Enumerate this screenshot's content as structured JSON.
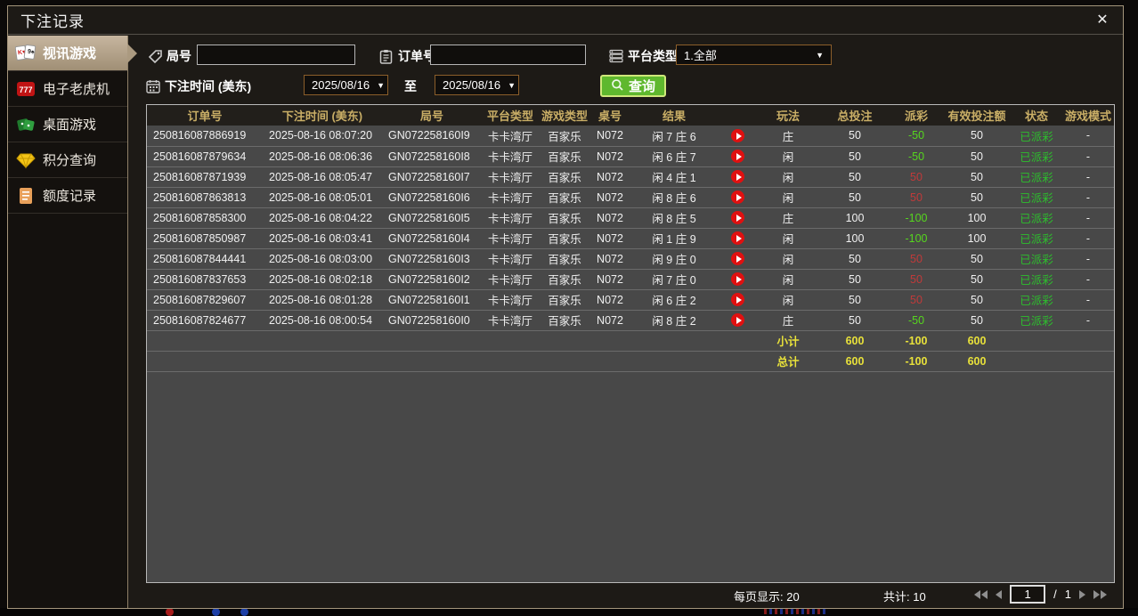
{
  "window": {
    "title": "下注记录",
    "close_glyph": "✕"
  },
  "sidebar": {
    "items": [
      {
        "label": "视讯游戏",
        "icon": "playing-cards-icon",
        "active": true
      },
      {
        "label": "电子老虎机",
        "icon": "slot-777-icon",
        "active": false
      },
      {
        "label": "桌面游戏",
        "icon": "dice-icon",
        "active": false
      },
      {
        "label": "积分查询",
        "icon": "diamond-icon",
        "active": false
      },
      {
        "label": "额度记录",
        "icon": "document-icon",
        "active": false
      }
    ]
  },
  "filters": {
    "round_label": "局号",
    "round_value": "",
    "order_label": "订单号",
    "order_value": "",
    "platform_label": "平台类型",
    "platform_value": "1.全部",
    "time_label": "下注时间 (美东)",
    "date_from": "2025/08/16",
    "to_label": "至",
    "date_to": "2025/08/16",
    "query_label": "查询"
  },
  "table": {
    "headers": [
      "订单号",
      "下注时间 (美东)",
      "局号",
      "平台类型",
      "游戏类型",
      "桌号",
      "结果",
      "",
      "玩法",
      "总投注",
      "派彩",
      "有效投注额",
      "状态",
      "游戏模式"
    ],
    "rows": [
      {
        "order_no": "250816087886919",
        "bet_time": "2025-08-16 08:07:20",
        "round_no": "GN072258160I9",
        "platform": "卡卡湾厅",
        "game_type": "百家乐",
        "table_no": "N072",
        "result": "闲 7 庄 6",
        "bet_type": "庄",
        "total_bet": "50",
        "payout": "-50",
        "payout_color": "green",
        "valid_bet": "50",
        "status": "已派彩",
        "mode": "-"
      },
      {
        "order_no": "250816087879634",
        "bet_time": "2025-08-16 08:06:36",
        "round_no": "GN072258160I8",
        "platform": "卡卡湾厅",
        "game_type": "百家乐",
        "table_no": "N072",
        "result": "闲 6 庄 7",
        "bet_type": "闲",
        "total_bet": "50",
        "payout": "-50",
        "payout_color": "green",
        "valid_bet": "50",
        "status": "已派彩",
        "mode": "-"
      },
      {
        "order_no": "250816087871939",
        "bet_time": "2025-08-16 08:05:47",
        "round_no": "GN072258160I7",
        "platform": "卡卡湾厅",
        "game_type": "百家乐",
        "table_no": "N072",
        "result": "闲 4 庄 1",
        "bet_type": "闲",
        "total_bet": "50",
        "payout": "50",
        "payout_color": "red",
        "valid_bet": "50",
        "status": "已派彩",
        "mode": "-"
      },
      {
        "order_no": "250816087863813",
        "bet_time": "2025-08-16 08:05:01",
        "round_no": "GN072258160I6",
        "platform": "卡卡湾厅",
        "game_type": "百家乐",
        "table_no": "N072",
        "result": "闲 8 庄 6",
        "bet_type": "闲",
        "total_bet": "50",
        "payout": "50",
        "payout_color": "red",
        "valid_bet": "50",
        "status": "已派彩",
        "mode": "-"
      },
      {
        "order_no": "250816087858300",
        "bet_time": "2025-08-16 08:04:22",
        "round_no": "GN072258160I5",
        "platform": "卡卡湾厅",
        "game_type": "百家乐",
        "table_no": "N072",
        "result": "闲 8 庄 5",
        "bet_type": "庄",
        "total_bet": "100",
        "payout": "-100",
        "payout_color": "green",
        "valid_bet": "100",
        "status": "已派彩",
        "mode": "-"
      },
      {
        "order_no": "250816087850987",
        "bet_time": "2025-08-16 08:03:41",
        "round_no": "GN072258160I4",
        "platform": "卡卡湾厅",
        "game_type": "百家乐",
        "table_no": "N072",
        "result": "闲 1 庄 9",
        "bet_type": "闲",
        "total_bet": "100",
        "payout": "-100",
        "payout_color": "green",
        "valid_bet": "100",
        "status": "已派彩",
        "mode": "-"
      },
      {
        "order_no": "250816087844441",
        "bet_time": "2025-08-16 08:03:00",
        "round_no": "GN072258160I3",
        "platform": "卡卡湾厅",
        "game_type": "百家乐",
        "table_no": "N072",
        "result": "闲 9 庄 0",
        "bet_type": "闲",
        "total_bet": "50",
        "payout": "50",
        "payout_color": "red",
        "valid_bet": "50",
        "status": "已派彩",
        "mode": "-"
      },
      {
        "order_no": "250816087837653",
        "bet_time": "2025-08-16 08:02:18",
        "round_no": "GN072258160I2",
        "platform": "卡卡湾厅",
        "game_type": "百家乐",
        "table_no": "N072",
        "result": "闲 7 庄 0",
        "bet_type": "闲",
        "total_bet": "50",
        "payout": "50",
        "payout_color": "red",
        "valid_bet": "50",
        "status": "已派彩",
        "mode": "-"
      },
      {
        "order_no": "250816087829607",
        "bet_time": "2025-08-16 08:01:28",
        "round_no": "GN072258160I1",
        "platform": "卡卡湾厅",
        "game_type": "百家乐",
        "table_no": "N072",
        "result": "闲 6 庄 2",
        "bet_type": "闲",
        "total_bet": "50",
        "payout": "50",
        "payout_color": "red",
        "valid_bet": "50",
        "status": "已派彩",
        "mode": "-"
      },
      {
        "order_no": "250816087824677",
        "bet_time": "2025-08-16 08:00:54",
        "round_no": "GN072258160I0",
        "platform": "卡卡湾厅",
        "game_type": "百家乐",
        "table_no": "N072",
        "result": "闲 8 庄 2",
        "bet_type": "庄",
        "total_bet": "50",
        "payout": "-50",
        "payout_color": "green",
        "valid_bet": "50",
        "status": "已派彩",
        "mode": "-"
      }
    ],
    "subtotal": {
      "label": "小计",
      "total_bet": "600",
      "payout": "-100",
      "valid_bet": "600"
    },
    "total": {
      "label": "总计",
      "total_bet": "600",
      "payout": "-100",
      "valid_bet": "600"
    }
  },
  "footer": {
    "per_page": "每页显示: 20",
    "total_count": "共计: 10",
    "page": "1",
    "page_sep": "/",
    "page_total": "1"
  }
}
